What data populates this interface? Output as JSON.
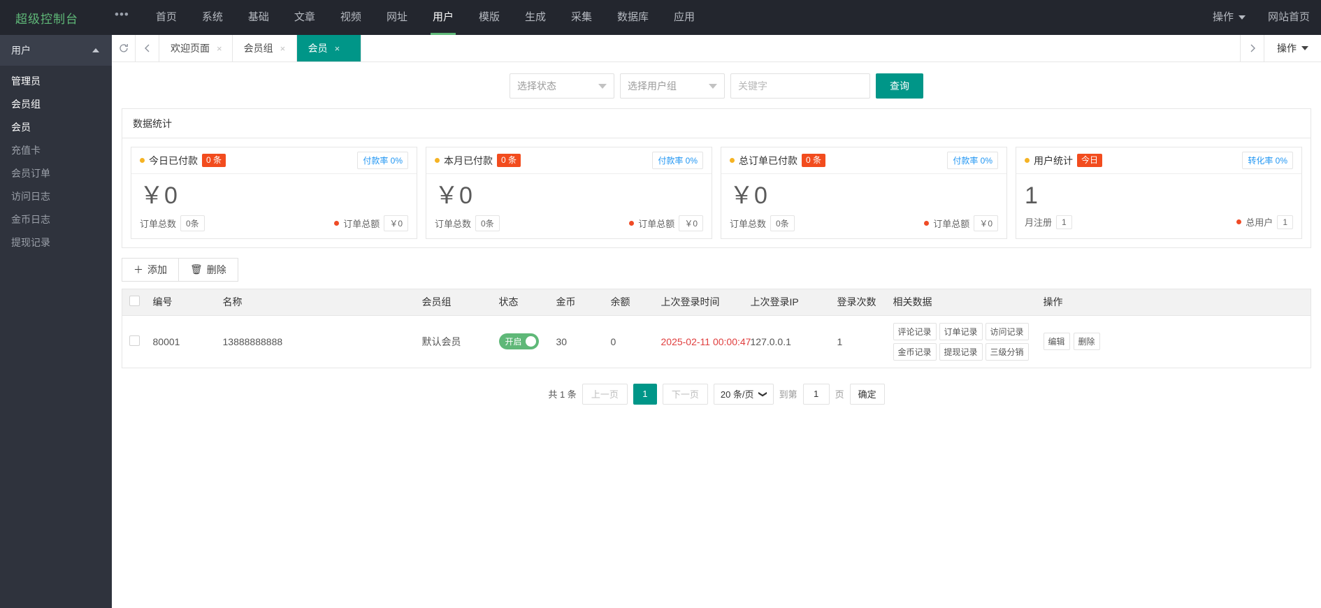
{
  "header": {
    "logo": "超级控制台",
    "dots_icon": "more-dots-icon",
    "nav": [
      {
        "label": "首页",
        "active": false
      },
      {
        "label": "系统",
        "active": false
      },
      {
        "label": "基础",
        "active": false
      },
      {
        "label": "文章",
        "active": false
      },
      {
        "label": "视频",
        "active": false
      },
      {
        "label": "网址",
        "active": false
      },
      {
        "label": "用户",
        "active": true
      },
      {
        "label": "模版",
        "active": false
      },
      {
        "label": "生成",
        "active": false
      },
      {
        "label": "采集",
        "active": false
      },
      {
        "label": "数据库",
        "active": false
      },
      {
        "label": "应用",
        "active": false
      }
    ],
    "right": [
      {
        "label": "操作",
        "has_caret": true
      },
      {
        "label": "网站首页",
        "has_caret": false
      }
    ]
  },
  "sidebar": {
    "group": {
      "label": "用户",
      "collapse_icon": "chevron-up-icon"
    },
    "items": [
      {
        "label": "管理员",
        "active": true
      },
      {
        "label": "会员组",
        "active": true
      },
      {
        "label": "会员",
        "active": true
      },
      {
        "label": "充值卡",
        "active": false
      },
      {
        "label": "会员订单",
        "active": false
      },
      {
        "label": "访问日志",
        "active": false
      },
      {
        "label": "金币日志",
        "active": false
      },
      {
        "label": "提现记录",
        "active": false
      }
    ]
  },
  "tabbar": {
    "refresh_icon": "refresh-icon",
    "prev_icon": "chevron-left-icon",
    "next_icon": "chevron-right-icon",
    "close_icon": "×",
    "tabs": [
      {
        "label": "欢迎页面",
        "active": false
      },
      {
        "label": "会员组",
        "active": false
      },
      {
        "label": "会员",
        "active": true
      }
    ],
    "action": {
      "label": "操作",
      "caret_icon": "caret-down-icon"
    }
  },
  "filter": {
    "status_select": "选择状态",
    "group_select": "选择用户组",
    "keyword_placeholder": "关键字",
    "keyword_value": "",
    "search_button": "查询"
  },
  "stats": {
    "panel_title": "数据统计",
    "cards": [
      {
        "title": "今日已付款",
        "badge": "0 条",
        "rate_label": "付款率 0%",
        "big_value": "￥0",
        "foot_left_label": "订单总数",
        "foot_left_value": "0条",
        "foot_right_label": "订单总额",
        "foot_right_value": "￥0"
      },
      {
        "title": "本月已付款",
        "badge": "0 条",
        "rate_label": "付款率 0%",
        "big_value": "￥0",
        "foot_left_label": "订单总数",
        "foot_left_value": "0条",
        "foot_right_label": "订单总额",
        "foot_right_value": "￥0"
      },
      {
        "title": "总订单已付款",
        "badge": "0 条",
        "rate_label": "付款率 0%",
        "big_value": "￥0",
        "foot_left_label": "订单总数",
        "foot_left_value": "0条",
        "foot_right_label": "订单总额",
        "foot_right_value": "￥0"
      },
      {
        "title": "用户统计",
        "badge": "今日",
        "rate_label": "转化率 0%",
        "big_value": "1",
        "foot_left_label": "月注册",
        "foot_left_value": "1",
        "foot_right_label": "总用户",
        "foot_right_value": "1"
      }
    ]
  },
  "toolbar": {
    "add_label": "添加",
    "add_icon": "plus-icon",
    "delete_label": "删除",
    "delete_icon": "trash-icon"
  },
  "table": {
    "columns": [
      "编号",
      "名称",
      "会员组",
      "状态",
      "金币",
      "余额",
      "上次登录时间",
      "上次登录IP",
      "登录次数",
      "相关数据",
      "操作"
    ],
    "rows": [
      {
        "id": "80001",
        "name": "13888888888",
        "group": "默认会员",
        "status": "开启",
        "coins": "30",
        "balance": "0",
        "last_login_time": "2025-02-11 00:00:47",
        "last_login_ip": "127.0.0.1",
        "login_count": "1",
        "related": [
          "评论记录",
          "订单记录",
          "访问记录",
          "金币记录",
          "提现记录",
          "三级分销"
        ],
        "ops": [
          "编辑",
          "删除"
        ]
      }
    ]
  },
  "pagination": {
    "total_label": "共 1 条",
    "prev": "上一页",
    "current_page": "1",
    "next": "下一页",
    "page_size": "20 条/页",
    "goto_label": "到第",
    "goto_value": "1",
    "page_unit": "页",
    "confirm": "确定"
  },
  "colors": {
    "brand_teal": "#009688",
    "nav_dark": "#23262E",
    "sidebar_dark": "#2F333D",
    "accent_green": "#5FB878",
    "badge_orange": "#F24C1E",
    "link_blue": "#2196F3",
    "date_red": "#e03e3e"
  }
}
